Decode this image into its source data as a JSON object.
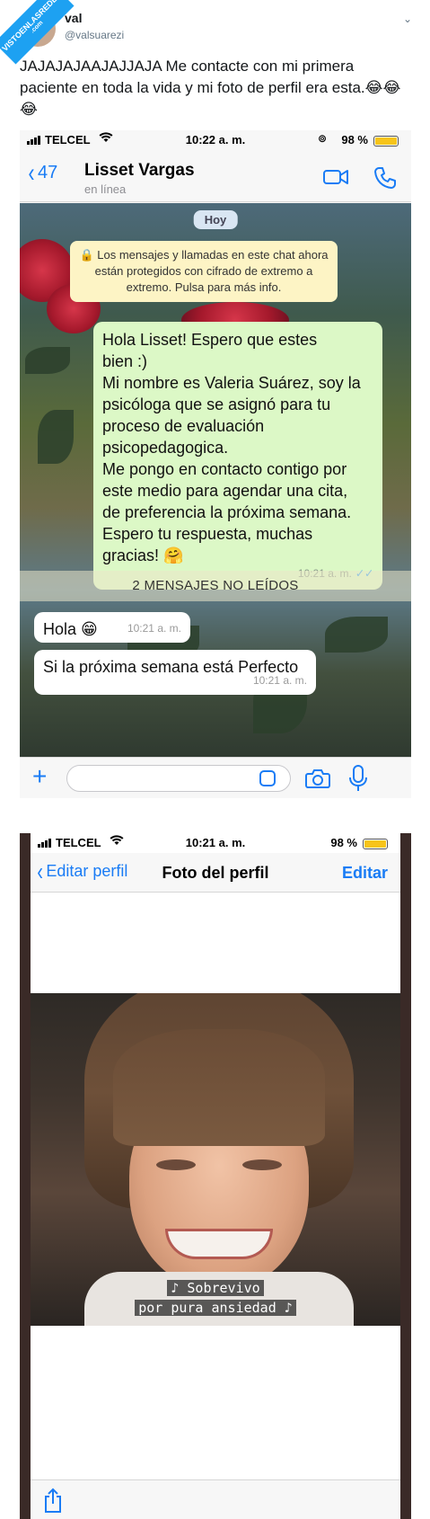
{
  "watermark": {
    "line1": "VISTOENLASREDES",
    "line2": ".com"
  },
  "tweet": {
    "name": "val",
    "handle": "@valsuarezi",
    "text": "JAJAJAJAAJAJJAJA Me contacte con mi primera paciente en toda la vida y mi foto de perfil era esta.😂😂😂"
  },
  "screenshot1": {
    "status": {
      "carrier": "TELCEL",
      "time": "10:22 a. m.",
      "battery": "98 %",
      "battery_level": 0.98
    },
    "header": {
      "back_count": "47",
      "contact_name": "Lisset Vargas",
      "contact_status": "en línea"
    },
    "date_pill": "Hoy",
    "encryption_note": "🔒 Los mensajes y llamadas en este chat ahora están protegidos con cifrado de extremo a extremo. Pulsa para más info.",
    "outgoing_message": {
      "lines": [
        "Hola Lisset! Espero que estes",
        "bien :)",
        "Mi nombre es Valeria Suárez, soy la",
        "psicóloga que se asignó para tu",
        "proceso de evaluación",
        "psicopedagogica.",
        "Me pongo en contacto contigo por",
        "este medio para agendar una cita,",
        "de preferencia la próxima semana.",
        "Espero tu respuesta, muchas",
        "gracias! 🤗"
      ],
      "time": "10:21 a. m.",
      "ticks": "✓✓"
    },
    "unread_banner": "2 MENSAJES NO LEÍDOS",
    "incoming_messages": [
      {
        "text": "Hola 😁",
        "time": "10:21 a. m."
      },
      {
        "text": "Si la próxima semana está Perfecto",
        "time": "10:21 a. m."
      }
    ]
  },
  "screenshot2": {
    "status": {
      "carrier": "TELCEL",
      "time": "10:21 a. m.",
      "battery": "98 %",
      "battery_level": 0.98
    },
    "nav": {
      "back_label": "Editar perfil",
      "title": "Foto del perfil",
      "edit_label": "Editar"
    },
    "photo_subtitles": [
      "♪ Sobrevivo",
      "por pura ansiedad ♪"
    ]
  },
  "colors": {
    "ios_blue": "#1a7cf5",
    "whatsapp_out_bubble": "#dcf8c6",
    "encryption_note_bg": "#fdf4c5",
    "twitter_blue": "#1da1f2"
  }
}
